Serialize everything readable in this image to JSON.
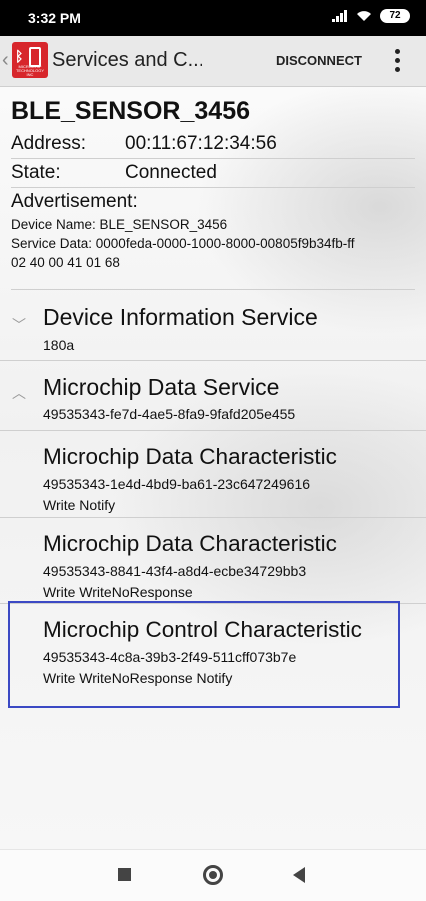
{
  "status_bar": {
    "time": "3:32 PM",
    "battery": "72"
  },
  "app_bar": {
    "back_glyph": "‹",
    "logo_text": "MICROCHIP TECHNOLOGY INC",
    "title": "Services and C...",
    "disconnect_label": "DISCONNECT"
  },
  "device": {
    "name": "BLE_SENSOR_3456",
    "address_label": "Address:",
    "address": "00:11:67:12:34:56",
    "state_label": "State:",
    "state": "Connected",
    "advertisement_label": "Advertisement:",
    "advertisement_lines": [
      "Device Name: BLE_SENSOR_3456",
      "Service Data: 0000feda-0000-1000-8000-00805f9b34fb-ff",
      "02 40 00 41 01 68"
    ]
  },
  "services": [
    {
      "title": "Device Information Service",
      "uuid": "180a",
      "chevron": "﹀"
    },
    {
      "title": "Microchip Data Service",
      "uuid": "49535343-fe7d-4ae5-8fa9-9fafd205e455",
      "chevron": "︿"
    }
  ],
  "characteristics": [
    {
      "title": "Microchip Data Characteristic",
      "uuid": "49535343-1e4d-4bd9-ba61-23c647249616",
      "props": "Write Notify"
    },
    {
      "title": "Microchip Data Characteristic",
      "uuid": "49535343-8841-43f4-a8d4-ecbe34729bb3",
      "props": "Write WriteNoResponse"
    },
    {
      "title": "Microchip Control Characteristic",
      "uuid": "49535343-4c8a-39b3-2f49-511cff073b7e",
      "props": "Write WriteNoResponse Notify"
    }
  ],
  "icons": {
    "status": [
      "signal-icon",
      "wifi-icon",
      "battery-icon"
    ],
    "nav": [
      "recents-icon",
      "home-icon",
      "back-icon"
    ]
  },
  "colors": {
    "highlight_border": "#3b49c4",
    "logo_red": "#d7262b"
  }
}
